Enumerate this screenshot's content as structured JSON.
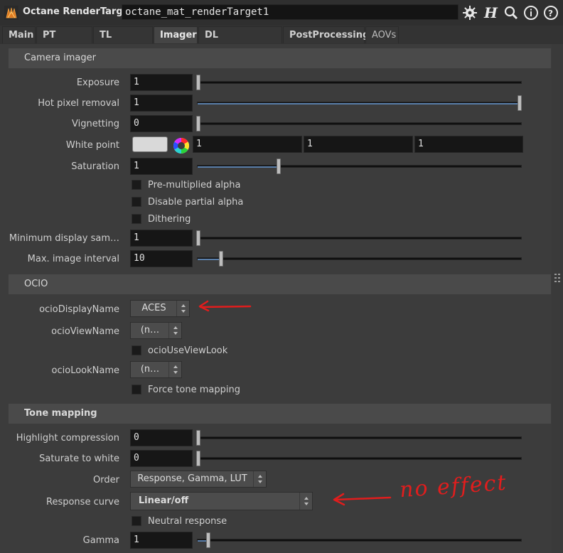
{
  "header": {
    "node_type": "Octane RenderTarget",
    "node_name": "octane_mat_renderTarget1",
    "icons": [
      "octane-logo-icon",
      "gear-icon",
      "houdini-h-icon",
      "search-icon",
      "info-icon",
      "help-icon"
    ]
  },
  "tabs": [
    {
      "label": "Main"
    },
    {
      "label": "PT Kernel"
    },
    {
      "label": "TL Camera"
    },
    {
      "label": "Imager"
    },
    {
      "label": "DL Environment"
    },
    {
      "label": "PostProcessing"
    },
    {
      "label": "AOVs"
    }
  ],
  "active_tab": "Imager",
  "camera_imager": {
    "title": "Camera imager",
    "exposure": {
      "label": "Exposure",
      "value": "1",
      "fraction": 0.0
    },
    "hot_pixel": {
      "label": "Hot pixel removal",
      "value": "1",
      "fraction": 1.0
    },
    "vignetting": {
      "label": "Vignetting",
      "value": "0",
      "fraction": 0.0
    },
    "white_point": {
      "label": "White point",
      "r": "1",
      "g": "1",
      "b": "1",
      "swatch": "#d9d9d9"
    },
    "saturation": {
      "label": "Saturation",
      "value": "1",
      "fraction": 0.25
    },
    "premult": {
      "label": "Pre-multiplied alpha"
    },
    "disable_partial": {
      "label": "Disable partial alpha"
    },
    "dithering": {
      "label": "Dithering"
    },
    "min_display": {
      "label": "Minimum display sam…",
      "value": "1",
      "fraction": 0.0
    },
    "max_interval": {
      "label": "Max. image interval",
      "value": "10",
      "fraction": 0.07
    }
  },
  "ocio": {
    "title": "OCIO",
    "display_name": {
      "label": "ocioDisplayName",
      "value": "ACES"
    },
    "view_name": {
      "label": "ocioViewName",
      "value": "(n…"
    },
    "use_view_look": {
      "label": "ocioUseViewLook"
    },
    "look_name": {
      "label": "ocioLookName",
      "value": "(n…"
    },
    "force_tone": {
      "label": "Force tone mapping"
    }
  },
  "tone_mapping": {
    "title": "Tone mapping",
    "highlight": {
      "label": "Highlight compression",
      "value": "0",
      "fraction": 0.0
    },
    "saturate_white": {
      "label": "Saturate to white",
      "value": "0",
      "fraction": 0.0
    },
    "order": {
      "label": "Order",
      "value": "Response, Gamma, LUT"
    },
    "response_curve": {
      "label": "Response curve",
      "value": "Linear/off"
    },
    "neutral": {
      "label": "Neutral response"
    },
    "gamma": {
      "label": "Gamma",
      "value": "1",
      "fraction": 0.03
    }
  },
  "annotation": {
    "text": "no effect",
    "color": "#e11d1d"
  },
  "colors": {
    "accent": "#5a7faa",
    "panel": "#3c3c3c",
    "header": "#2f2f2f"
  }
}
